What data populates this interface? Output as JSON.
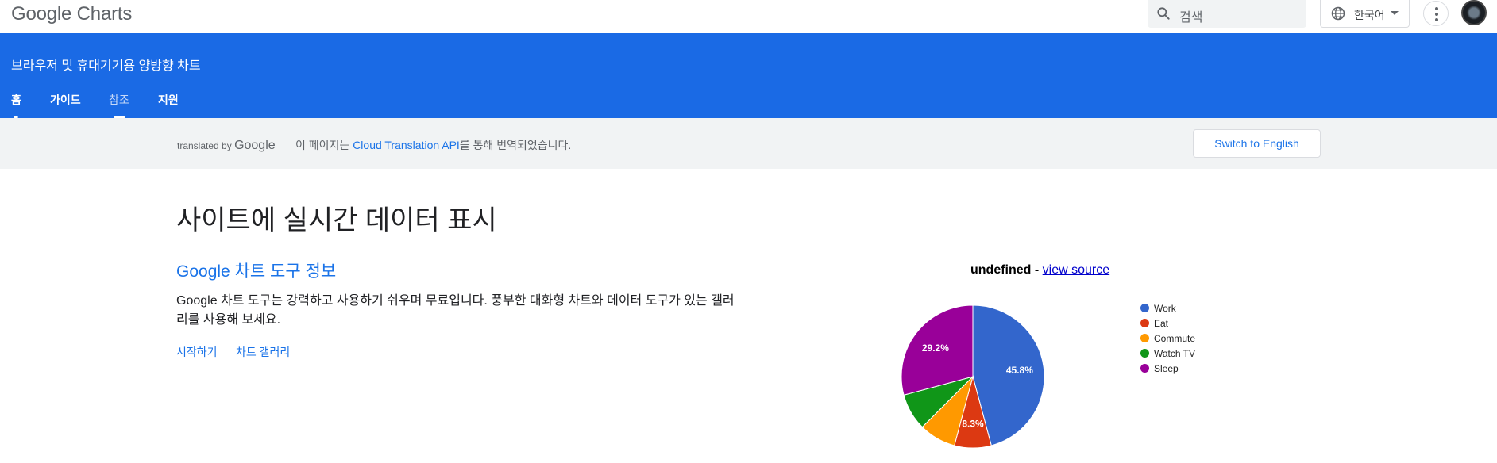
{
  "topbar": {
    "logo": "Google Charts",
    "search_placeholder": "검색",
    "language": "한국어"
  },
  "header": {
    "subtitle": "브라우저 및 휴대기기용 양방향 차트",
    "tabs": [
      {
        "label": "홈"
      },
      {
        "label": "가이드"
      },
      {
        "label": "참조"
      },
      {
        "label": "지원"
      }
    ]
  },
  "banner": {
    "translated_by": "translated by",
    "google": "Google",
    "msg_prefix": "이 페이지는",
    "api_link": "Cloud Translation API",
    "msg_suffix": "를 통해 번역되었습니다.",
    "switch_label": "Switch to English"
  },
  "main": {
    "title": "사이트에 실시간 데이터 표시",
    "section_title": "Google 차트 도구 정보",
    "paragraph": "Google 차트 도구는 강력하고 사용하기 쉬우며 무료입니다. 풍부한 대화형 차트와 데이터 도구가 있는 갤러리를 사용해 보세요.",
    "links": [
      {
        "label": "시작하기"
      },
      {
        "label": "차트 갤러리"
      }
    ]
  },
  "chart_data": {
    "type": "pie",
    "title": "undefined",
    "title_separator": " - ",
    "title_link": "view source",
    "categories": [
      "Work",
      "Eat",
      "Commute",
      "Watch TV",
      "Sleep"
    ],
    "values": [
      11,
      2,
      2,
      2,
      7
    ],
    "labels": [
      "45.8%",
      "8.3%",
      "",
      "",
      "29.2%"
    ],
    "colors": [
      "#3366cc",
      "#dc3912",
      "#ff9900",
      "#109618",
      "#990099"
    ],
    "legend": "right"
  }
}
